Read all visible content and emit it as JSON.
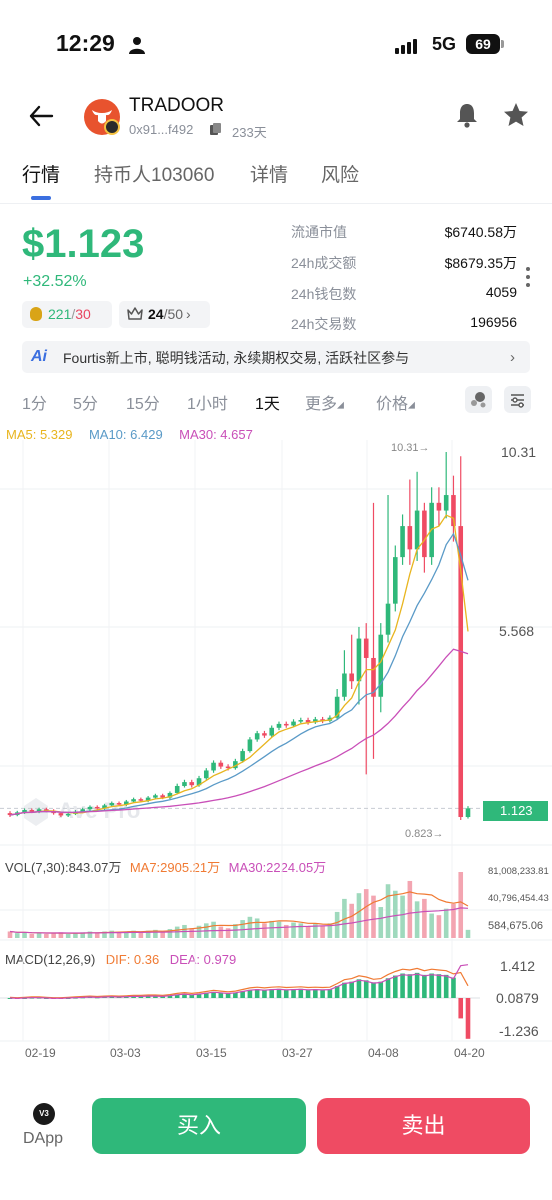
{
  "status_bar": {
    "time": "12:29",
    "network": "5G",
    "battery": "69"
  },
  "header": {
    "token_name": "TRADOOR",
    "address": "0x91...f492",
    "age": "233天"
  },
  "tabs": [
    {
      "label": "行情",
      "active": true
    },
    {
      "label": "持币人103060",
      "active": false
    },
    {
      "label": "详情",
      "active": false
    },
    {
      "label": "风险",
      "active": false
    }
  ],
  "price": {
    "value": "$1.123",
    "change": "+32.52%",
    "pill_holders": {
      "green": "221",
      "sep": "/",
      "red": "30"
    },
    "pill_rank": {
      "value": "24",
      "total": "/50"
    }
  },
  "stats": [
    {
      "label": "流通市值",
      "value": "$6740.58万"
    },
    {
      "label": "24h成交额",
      "value": "$8679.35万"
    },
    {
      "label": "24h钱包数",
      "value": "4059"
    },
    {
      "label": "24h交易数",
      "value": "196956"
    }
  ],
  "announcement": {
    "icon": "Ai",
    "text": "Fourtis新上市, 聪明钱活动, 永续期权交易, 活跃社区参与"
  },
  "intervals": [
    {
      "label": "1分",
      "active": false
    },
    {
      "label": "5分",
      "active": false
    },
    {
      "label": "15分",
      "active": false
    },
    {
      "label": "1小时",
      "active": false
    },
    {
      "label": "1天",
      "active": true
    },
    {
      "label": "更多",
      "active": false
    },
    {
      "label": "价格",
      "active": false
    }
  ],
  "colors": {
    "up": "#2fb87a",
    "down": "#ef4b63",
    "ma5": "#e8b51f",
    "ma10": "#5a9ac7",
    "ma30": "#c94fb8",
    "accent": "#3b6fe0"
  },
  "legends": {
    "main": [
      {
        "text": "MA5: 5.329",
        "color": "#e8b51f"
      },
      {
        "text": "MA10: 6.429",
        "color": "#5a9ac7"
      },
      {
        "text": "MA30: 4.657",
        "color": "#c94fb8"
      }
    ],
    "vol": [
      {
        "text": "VOL(7,30):843.07万",
        "color": "#444444"
      },
      {
        "text": "MA7:2905.21万",
        "color": "#f07a33"
      },
      {
        "text": "MA30:2224.05万",
        "color": "#c94fb8"
      }
    ],
    "macd": [
      {
        "text": "MACD(12,26,9)",
        "color": "#444444"
      },
      {
        "text": "DIF: 0.36",
        "color": "#f07a33"
      },
      {
        "text": "DEA: 0.979",
        "color": "#c94fb8"
      }
    ]
  },
  "chart_data": {
    "type": "candlestick",
    "price_axis": [
      "10.31",
      "5.568"
    ],
    "current_price_label": "1.123",
    "high_marker": "10.31→",
    "low_marker": "0.823→",
    "watermark": "Ave Pro",
    "vol_axis": [
      "81,008,233.81",
      "40,796,454.43",
      "584,675.06"
    ],
    "macd_axis": [
      "1.412",
      "0.0879",
      "-1.236"
    ],
    "x_labels": [
      "02-19",
      "03-03",
      "03-15",
      "03-27",
      "04-08",
      "04-20"
    ],
    "candles": [
      [
        1.0,
        0.95,
        1.05,
        0.9
      ],
      [
        0.95,
        1.02,
        1.06,
        0.92
      ],
      [
        1.02,
        1.08,
        1.12,
        0.98
      ],
      [
        1.08,
        1.04,
        1.12,
        1.0
      ],
      [
        1.04,
        1.1,
        1.14,
        1.0
      ],
      [
        1.1,
        1.06,
        1.14,
        1.02
      ],
      [
        1.06,
        1.0,
        1.1,
        0.96
      ],
      [
        1.0,
        0.94,
        1.04,
        0.9
      ],
      [
        0.94,
        0.98,
        1.02,
        0.9
      ],
      [
        0.98,
        1.04,
        1.08,
        0.95
      ],
      [
        1.04,
        1.1,
        1.14,
        1.0
      ],
      [
        1.1,
        1.16,
        1.2,
        1.06
      ],
      [
        1.16,
        1.12,
        1.2,
        1.08
      ],
      [
        1.12,
        1.2,
        1.24,
        1.08
      ],
      [
        1.2,
        1.26,
        1.3,
        1.16
      ],
      [
        1.26,
        1.22,
        1.3,
        1.18
      ],
      [
        1.22,
        1.3,
        1.34,
        1.18
      ],
      [
        1.3,
        1.36,
        1.4,
        1.26
      ],
      [
        1.36,
        1.32,
        1.4,
        1.28
      ],
      [
        1.32,
        1.4,
        1.44,
        1.28
      ],
      [
        1.4,
        1.46,
        1.5,
        1.36
      ],
      [
        1.46,
        1.4,
        1.5,
        1.36
      ],
      [
        1.4,
        1.52,
        1.56,
        1.36
      ],
      [
        1.52,
        1.7,
        1.76,
        1.48
      ],
      [
        1.7,
        1.8,
        1.86,
        1.66
      ],
      [
        1.8,
        1.72,
        1.86,
        1.66
      ],
      [
        1.72,
        1.9,
        1.96,
        1.68
      ],
      [
        1.9,
        2.1,
        2.16,
        1.86
      ],
      [
        2.1,
        2.3,
        2.36,
        2.04
      ],
      [
        2.3,
        2.2,
        2.36,
        2.14
      ],
      [
        2.2,
        2.16,
        2.26,
        2.1
      ],
      [
        2.16,
        2.34,
        2.4,
        2.12
      ],
      [
        2.34,
        2.6,
        2.66,
        2.3
      ],
      [
        2.6,
        2.9,
        2.96,
        2.56
      ],
      [
        2.9,
        3.06,
        3.12,
        2.84
      ],
      [
        3.06,
        3.0,
        3.12,
        2.94
      ],
      [
        3.0,
        3.2,
        3.26,
        2.96
      ],
      [
        3.2,
        3.3,
        3.36,
        3.14
      ],
      [
        3.3,
        3.26,
        3.36,
        3.2
      ],
      [
        3.26,
        3.36,
        3.42,
        3.22
      ],
      [
        3.36,
        3.4,
        3.46,
        3.32
      ],
      [
        3.4,
        3.34,
        3.46,
        3.28
      ],
      [
        3.34,
        3.42,
        3.48,
        3.3
      ],
      [
        3.42,
        3.38,
        3.48,
        3.32
      ],
      [
        3.38,
        3.46,
        3.52,
        3.34
      ],
      [
        3.46,
        4.0,
        4.2,
        3.4
      ],
      [
        4.0,
        4.6,
        5.2,
        3.9
      ],
      [
        4.6,
        4.4,
        5.6,
        4.2
      ],
      [
        4.4,
        5.5,
        5.8,
        3.8
      ],
      [
        5.5,
        5.0,
        5.9,
        2.0
      ],
      [
        5.0,
        4.0,
        9.0,
        2.4
      ],
      [
        4.0,
        5.6,
        5.9,
        3.6
      ],
      [
        5.6,
        6.4,
        9.2,
        5.4
      ],
      [
        6.4,
        7.6,
        7.9,
        6.2
      ],
      [
        7.6,
        8.4,
        8.7,
        7.4
      ],
      [
        8.4,
        7.8,
        9.6,
        7.4
      ],
      [
        7.8,
        8.8,
        9.8,
        7.5
      ],
      [
        8.8,
        7.6,
        9.0,
        7.2
      ],
      [
        7.6,
        9.0,
        9.4,
        7.4
      ],
      [
        9.0,
        8.8,
        9.4,
        8.4
      ],
      [
        8.8,
        9.2,
        10.31,
        8.6
      ],
      [
        9.2,
        8.4,
        9.7,
        8.0
      ],
      [
        8.4,
        0.9,
        10.2,
        0.823
      ],
      [
        0.9,
        1.123,
        1.18,
        0.86
      ]
    ],
    "vol_ticks": [
      "81,008,233.81",
      "40,796,454.43",
      "584,675.06"
    ],
    "volumes": [
      8,
      6,
      7,
      5,
      6,
      5,
      6,
      7,
      5,
      6,
      7,
      8,
      6,
      8,
      9,
      7,
      8,
      9,
      7,
      9,
      10,
      8,
      11,
      14,
      16,
      12,
      15,
      18,
      20,
      14,
      12,
      17,
      22,
      26,
      24,
      18,
      21,
      20,
      16,
      19,
      18,
      14,
      17,
      15,
      18,
      32,
      48,
      42,
      55,
      60,
      52,
      38,
      66,
      58,
      52,
      70,
      45,
      48,
      30,
      28,
      36,
      42,
      81,
      10
    ],
    "macd_hist": [
      0.0,
      -0.01,
      0.0,
      0.01,
      0.01,
      0.0,
      -0.01,
      -0.01,
      0.0,
      0.01,
      0.02,
      0.03,
      0.02,
      0.03,
      0.04,
      0.03,
      0.04,
      0.05,
      0.05,
      0.06,
      0.06,
      0.05,
      0.07,
      0.1,
      0.12,
      0.1,
      0.12,
      0.15,
      0.18,
      0.16,
      0.14,
      0.16,
      0.2,
      0.24,
      0.26,
      0.24,
      0.26,
      0.27,
      0.25,
      0.26,
      0.27,
      0.25,
      0.26,
      0.25,
      0.26,
      0.35,
      0.45,
      0.48,
      0.55,
      0.52,
      0.46,
      0.48,
      0.58,
      0.66,
      0.72,
      0.7,
      0.74,
      0.68,
      0.72,
      0.7,
      0.68,
      0.6,
      -0.6,
      -1.2
    ]
  },
  "footer": {
    "dapp_badge": "V3",
    "dapp_label": "DApp",
    "buy_label": "买入",
    "sell_label": "卖出"
  }
}
